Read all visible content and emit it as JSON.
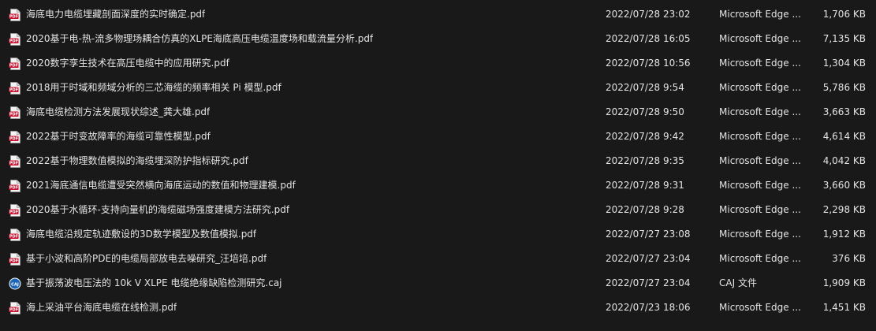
{
  "files": [
    {
      "name": "海底电力电缆埋藏剖面深度的实时确定.pdf",
      "date": "2022/07/28 23:02",
      "type": "Microsoft Edge ...",
      "size": "1,706 KB",
      "icon": "pdf-icon"
    },
    {
      "name": "2020基于电-热-流多物理场耦合仿真的XLPE海底高压电缆温度场和载流量分析.pdf",
      "date": "2022/07/28 16:05",
      "type": "Microsoft Edge ...",
      "size": "7,135 KB",
      "icon": "pdf-icon"
    },
    {
      "name": "2020数字孪生技术在高压电缆中的应用研究.pdf",
      "date": "2022/07/28 10:56",
      "type": "Microsoft Edge ...",
      "size": "1,304 KB",
      "icon": "pdf-icon"
    },
    {
      "name": "2018用于时域和频域分析的三芯海缆的频率相关 Pi 模型.pdf",
      "date": "2022/07/28 9:54",
      "type": "Microsoft Edge ...",
      "size": "5,786 KB",
      "icon": "pdf-icon"
    },
    {
      "name": "海底电缆检测方法发展现状综述_龚大雄.pdf",
      "date": "2022/07/28 9:50",
      "type": "Microsoft Edge ...",
      "size": "3,663 KB",
      "icon": "pdf-icon"
    },
    {
      "name": "2022基于时变故障率的海缆可靠性模型.pdf",
      "date": "2022/07/28 9:42",
      "type": "Microsoft Edge ...",
      "size": "4,614 KB",
      "icon": "pdf-icon"
    },
    {
      "name": "2022基于物理数值模拟的海缆埋深防护指标研究.pdf",
      "date": "2022/07/28 9:35",
      "type": "Microsoft Edge ...",
      "size": "4,042 KB",
      "icon": "pdf-icon"
    },
    {
      "name": "2021海底通信电缆遭受突然横向海底运动的数值和物理建模.pdf",
      "date": "2022/07/28 9:31",
      "type": "Microsoft Edge ...",
      "size": "3,660 KB",
      "icon": "pdf-icon"
    },
    {
      "name": "2020基于水循环-支持向量机的海缆磁场强度建模方法研究.pdf",
      "date": "2022/07/28 9:28",
      "type": "Microsoft Edge ...",
      "size": "2,298 KB",
      "icon": "pdf-icon"
    },
    {
      "name": "海底电缆沿规定轨迹敷设的3D数学模型及数值模拟.pdf",
      "date": "2022/07/27 23:08",
      "type": "Microsoft Edge ...",
      "size": "1,912 KB",
      "icon": "pdf-icon"
    },
    {
      "name": "基于小波和高阶PDE的电缆局部放电去噪研究_汪培培.pdf",
      "date": "2022/07/27 23:04",
      "type": "Microsoft Edge ...",
      "size": "376 KB",
      "icon": "pdf-icon"
    },
    {
      "name": "基于振荡波电压法的 10k V XLPE 电缆绝缘缺陷检测研究.caj",
      "date": "2022/07/27 23:04",
      "type": "CAJ 文件",
      "size": "1,909 KB",
      "icon": "caj-icon"
    },
    {
      "name": "海上采油平台海底电缆在线检测.pdf",
      "date": "2022/07/23 18:06",
      "type": "Microsoft Edge ...",
      "size": "1,451 KB",
      "icon": "pdf-icon"
    }
  ],
  "icon_labels": {
    "pdf": "PDF",
    "caj": "CAJ"
  },
  "colors": {
    "background": "#191919",
    "text": "#e4e4e4",
    "pdf_red": "#c8102e",
    "caj_blue": "#1b64b6"
  }
}
